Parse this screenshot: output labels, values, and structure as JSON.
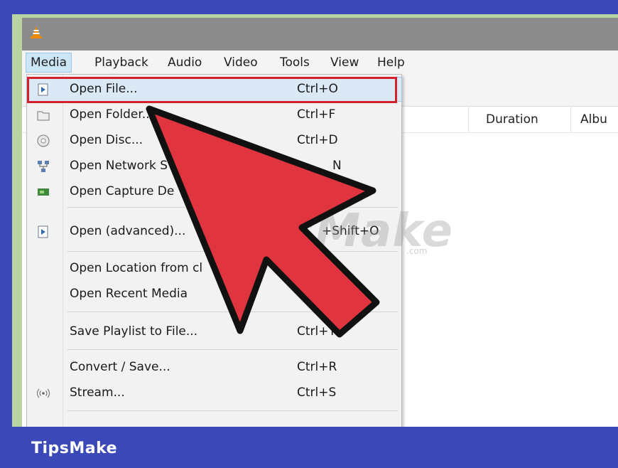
{
  "menubar": {
    "items": [
      "Media",
      "Playback",
      "Audio",
      "Video",
      "Tools",
      "View",
      "Help"
    ],
    "active": "Media"
  },
  "playlist": {
    "columns": [
      "Duration",
      "Albu"
    ]
  },
  "media_menu": {
    "items": [
      {
        "label": "Open File...",
        "shortcut": "Ctrl+O",
        "icon": "open-file-icon"
      },
      {
        "label": "Open Folder...",
        "shortcut": "Ctrl+F",
        "icon": "folder-icon"
      },
      {
        "label": "Open Disc...",
        "shortcut": "Ctrl+D",
        "icon": "disc-icon"
      },
      {
        "label": "Open Network S",
        "shortcut": "N",
        "icon": "network-icon"
      },
      {
        "label": "Open Capture De",
        "shortcut": "",
        "icon": "capture-card-icon"
      },
      {
        "label": "Open (advanced)...",
        "shortcut": "+Shift+O",
        "icon": "open-advanced-icon"
      },
      {
        "label": "Open Location from cl",
        "shortcut": "",
        "icon": ""
      },
      {
        "label": "Open Recent Media",
        "shortcut": "",
        "icon": ""
      },
      {
        "label": "Save Playlist to File...",
        "shortcut": "Ctrl+Y",
        "icon": ""
      },
      {
        "label": "Convert / Save...",
        "shortcut": "Ctrl+R",
        "icon": ""
      },
      {
        "label": "Stream...",
        "shortcut": "Ctrl+S",
        "icon": "stream-icon"
      }
    ],
    "highlighted": "Open File..."
  },
  "watermark": {
    "text": "TipsMake",
    "small": ".com"
  },
  "footer": {
    "brand": "TipsMake"
  },
  "colors": {
    "frame_blue": "#3b49b8",
    "highlight_red": "#d51f2a",
    "arrow_red": "#e0343f"
  }
}
